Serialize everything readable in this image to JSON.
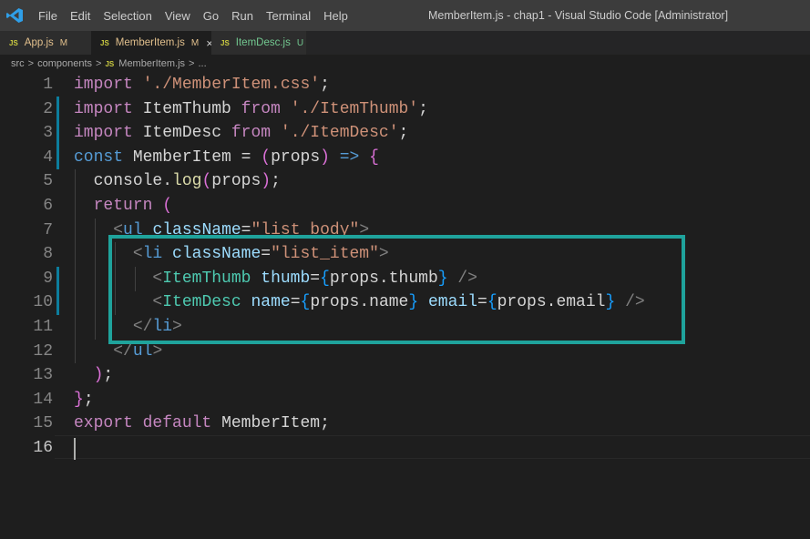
{
  "titlebar": {
    "menu": [
      "File",
      "Edit",
      "Selection",
      "View",
      "Go",
      "Run",
      "Terminal",
      "Help"
    ],
    "window_title": "MemberItem.js - chap1 - Visual Studio Code [Administrator]"
  },
  "tabs": [
    {
      "icon": "JS",
      "label": "App.js",
      "status": "M"
    },
    {
      "icon": "JS",
      "label": "MemberItem.js",
      "status": "M",
      "close": "×"
    },
    {
      "icon": "JS",
      "label": "ItemDesc.js",
      "status": "U"
    }
  ],
  "breadcrumb": {
    "items": [
      "src",
      "components",
      "MemberItem.js",
      "..."
    ],
    "separator": ">",
    "file_icon": "JS"
  },
  "editor": {
    "line_numbers": [
      "1",
      "2",
      "3",
      "4",
      "5",
      "6",
      "7",
      "8",
      "9",
      "10",
      "11",
      "12",
      "13",
      "14",
      "15",
      "16"
    ],
    "current_line": "16",
    "highlight_color": "#1fa39c"
  },
  "code_lines": [
    "import './MemberItem.css';",
    "import ItemThumb from './ItemThumb';",
    "import ItemDesc from './ItemDesc';",
    "const MemberItem = (props) => {",
    "  console.log(props);",
    "  return (",
    "    <ul className=\"list_body\">",
    "      <li className=\"list_item\">",
    "        <ItemThumb thumb={props.thumb} />",
    "        <ItemDesc name={props.name} email={props.email} />",
    "      </li>",
    "    </ul>",
    "  );",
    "};",
    "export default MemberItem;",
    ""
  ]
}
